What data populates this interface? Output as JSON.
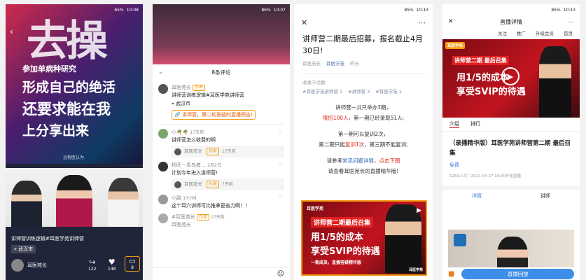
{
  "p1": {
    "status": "65%",
    "time": "10:08",
    "big_text": "去操",
    "line1": "参加单病种研究",
    "line2": "形成自己的绝活",
    "line3": "还要求能在我",
    "line4": "上分享出来",
    "sig": "远程医认为",
    "caption": "讲师营训练逻辑#耳医学苑讲师营",
    "location": "武汉市",
    "author": "耳医苑长",
    "share_count": "122",
    "like_count": "148",
    "comment_count": "8"
  },
  "p2": {
    "status": "86%",
    "time": "10:07",
    "title": "8条评论",
    "c1_name": "耳医苑长",
    "c1_tag": "作者",
    "c1_text": "讲师营训练逻辑#耳医学苑讲师营",
    "c1_loc": "武汉市",
    "c1_link": "讲师营，第二轮答疑的直播预告!",
    "c2_name": "小🌴🌴",
    "c2_time": "17天前",
    "c2_text": "讲师营怎么收费的啊",
    "c2_reply_name": "耳医苑长",
    "c2_reply_tag": "作者",
    "c2_reply_time": "17天前",
    "c3_name": "杨旺－青岛者…",
    "c3_time": "2月2日",
    "c3_text": "计划今年进入讲师营!",
    "c3_reply_name": "耳医苑长",
    "c3_reply_tag": "作者",
    "c3_reply_time": "7天前",
    "c4_name": "小路",
    "c4_time": "17小时",
    "c4_text": "这个耳穴训师可比推拿更省力啊！！",
    "c5_name": "#耳医苑长",
    "c5_tag": "作者",
    "c5_time": "17天前",
    "c5_text": "耳医苑长"
  },
  "p3": {
    "status": "85%",
    "time": "10:13",
    "headline": "讲师营二期最后招募，报名截止4月30日!",
    "meta_author": "耳医苑长",
    "meta_tag": "耳医学苑",
    "meta_time": "昨天",
    "collection_label": "收录于话题",
    "topics": [
      "#耳医学苑讲师营 1",
      "#讲师营 3",
      "#耳医学苑 1"
    ],
    "p_line1a": "讲师营一共只举办3期，",
    "p_line2_red": "限招100人",
    "p_line2b": "，第一期已经录取51人;",
    "p_line3": "第一期可以复训2次，",
    "p_line4a": "第二期只能",
    "p_line4_red": "复训1次",
    "p_line4b": "，第三期不能复训;",
    "p_line5a": "请参考",
    "p_line5_blue": "常见问题详情",
    "p_line5_red": "，点击下图",
    "p_line6": "请查看耳医苑长的直播精华版!",
    "poster_brand": "耳医学苑",
    "poster_l1": "讲师营二期最后召集",
    "poster_l2": "用1/5的成本",
    "poster_l3": "享受SVIP的待遇",
    "poster_l4": "一期成员，直播答疑精华版",
    "poster_sign": "耳医学苑"
  },
  "p4": {
    "status": "85%",
    "time": "10:13",
    "title": "直播详情",
    "nav": [
      "关注",
      "推广",
      "升级会员",
      "首页"
    ],
    "poster_brand": "耳医学苑",
    "poster_l1": "讲师营二期 最后召集",
    "poster_l2": "用1/5的成本",
    "poster_l3": "享受SVIP的待遇",
    "tabs": [
      "介绍",
      "排行"
    ],
    "course_title": "（录播精华版）耳医学苑讲师营第二期 最后召集",
    "price": "免费",
    "stats": "1259人次｜2021-04-27 19:00开始直播",
    "tabs2": [
      "详情",
      "讲师"
    ],
    "cta": "直播回放"
  }
}
